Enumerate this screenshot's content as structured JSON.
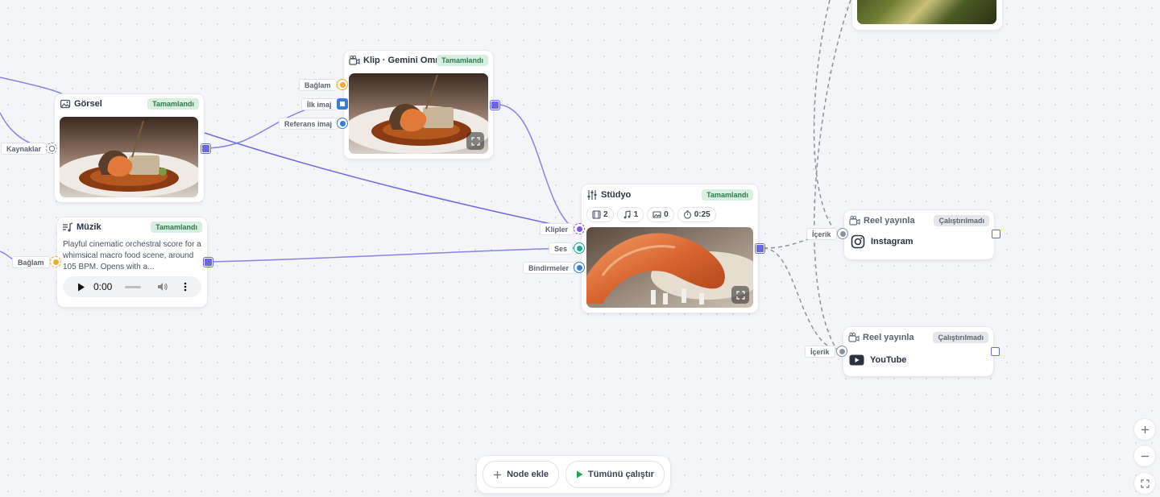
{
  "nodes": {
    "gorsel": {
      "title": "Görsel",
      "status": "Tamamlandı"
    },
    "muzik": {
      "title": "Müzik",
      "status": "Tamamlandı",
      "description": "Playful cinematic orchestral score for a whimsical macro food scene, around 105 BPM. Opens with a...",
      "audio_time": "0:00"
    },
    "klip": {
      "title": "Klip · Gemini Omni",
      "status": "Tamamlandı"
    },
    "studyo": {
      "title": "Stüdyo",
      "status": "Tamamlandı",
      "stats": {
        "clips": "2",
        "music": "1",
        "overlays": "0",
        "duration": "0:25"
      }
    },
    "reel_instagram": {
      "title": "Reel yayınla",
      "status": "Çalıştırılmadı",
      "platform": "Instagram"
    },
    "reel_youtube": {
      "title": "Reel yayınla",
      "status": "Çalıştırılmadı",
      "platform": "YouTube"
    }
  },
  "ports": {
    "kaynaklar": "Kaynaklar",
    "baglam_muzik": "Bağlam",
    "baglam_klip": "Bağlam",
    "ilk_imaj": "İlk imaj",
    "referans_imaj": "Referans imaj",
    "klipler": "Klipler",
    "ses": "Ses",
    "bindirmeler": "Bindirmeler",
    "icerik_instagram": "İçerik",
    "icerik_youtube": "İçerik"
  },
  "toolbar": {
    "add_node": "Node ekle",
    "run_all": "Tümünü çalıştır"
  },
  "colors": {
    "accent": "#6a67e3",
    "success_bg": "#d7efe0",
    "success_text": "#2f7a4d",
    "canvas": "#f3f5f8"
  }
}
